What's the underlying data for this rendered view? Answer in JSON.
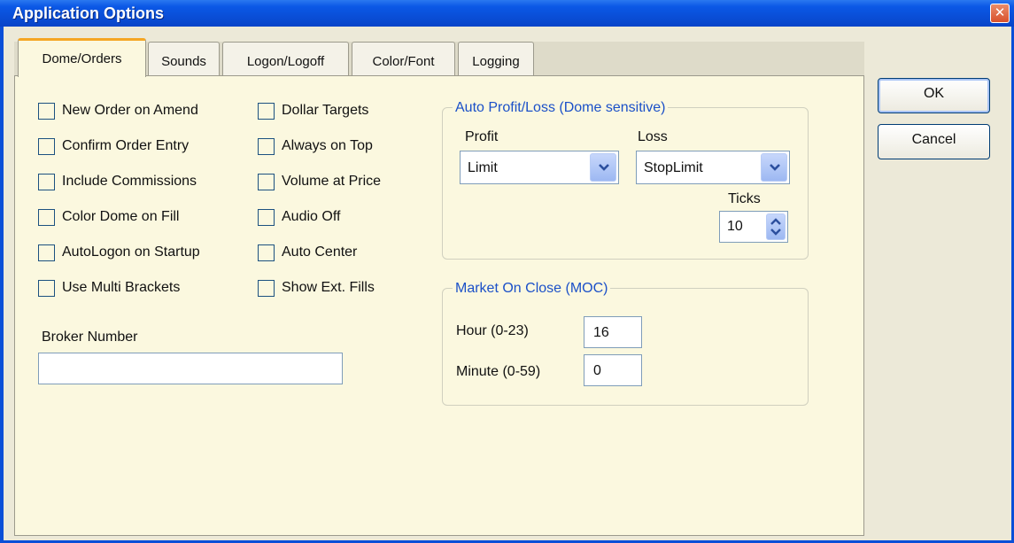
{
  "window": {
    "title": "Application Options",
    "close_glyph": "✕",
    "colors": {
      "titlebar": "#0a4fd8",
      "panel": "#fbf8df",
      "group_title": "#1b50c8",
      "active_tab_accent": "#f5a623"
    }
  },
  "tabs": [
    {
      "label": "Dome/Orders",
      "active": true
    },
    {
      "label": "Sounds",
      "active": false
    },
    {
      "label": "Logon/Logoff",
      "active": false
    },
    {
      "label": "Color/Font",
      "active": false
    },
    {
      "label": "Logging",
      "active": false
    }
  ],
  "options_left": [
    {
      "label": "New Order on Amend",
      "checked": false
    },
    {
      "label": "Confirm Order Entry",
      "checked": false
    },
    {
      "label": "Include Commissions",
      "checked": false
    },
    {
      "label": "Color Dome on Fill",
      "checked": false
    },
    {
      "label": "AutoLogon on Startup",
      "checked": false
    },
    {
      "label": "Use Multi Brackets",
      "checked": false
    }
  ],
  "options_right": [
    {
      "label": "Dollar Targets",
      "checked": false
    },
    {
      "label": "Always on Top",
      "checked": false
    },
    {
      "label": "Volume at Price",
      "checked": false
    },
    {
      "label": "Audio Off",
      "checked": false
    },
    {
      "label": "Auto Center",
      "checked": false
    },
    {
      "label": "Show Ext. Fills",
      "checked": false
    }
  ],
  "broker": {
    "label": "Broker Number",
    "value": ""
  },
  "auto_profit_loss": {
    "title": "Auto Profit/Loss (Dome sensitive)",
    "profit_label": "Profit",
    "profit_value": "Limit",
    "loss_label": "Loss",
    "loss_value": "StopLimit",
    "ticks_label": "Ticks",
    "ticks_value": "10"
  },
  "moc": {
    "title": "Market On Close (MOC)",
    "hour_label": "Hour (0-23)",
    "hour_value": "16",
    "minute_label": "Minute (0-59)",
    "minute_value": "0"
  },
  "buttons": {
    "ok": "OK",
    "cancel": "Cancel"
  }
}
